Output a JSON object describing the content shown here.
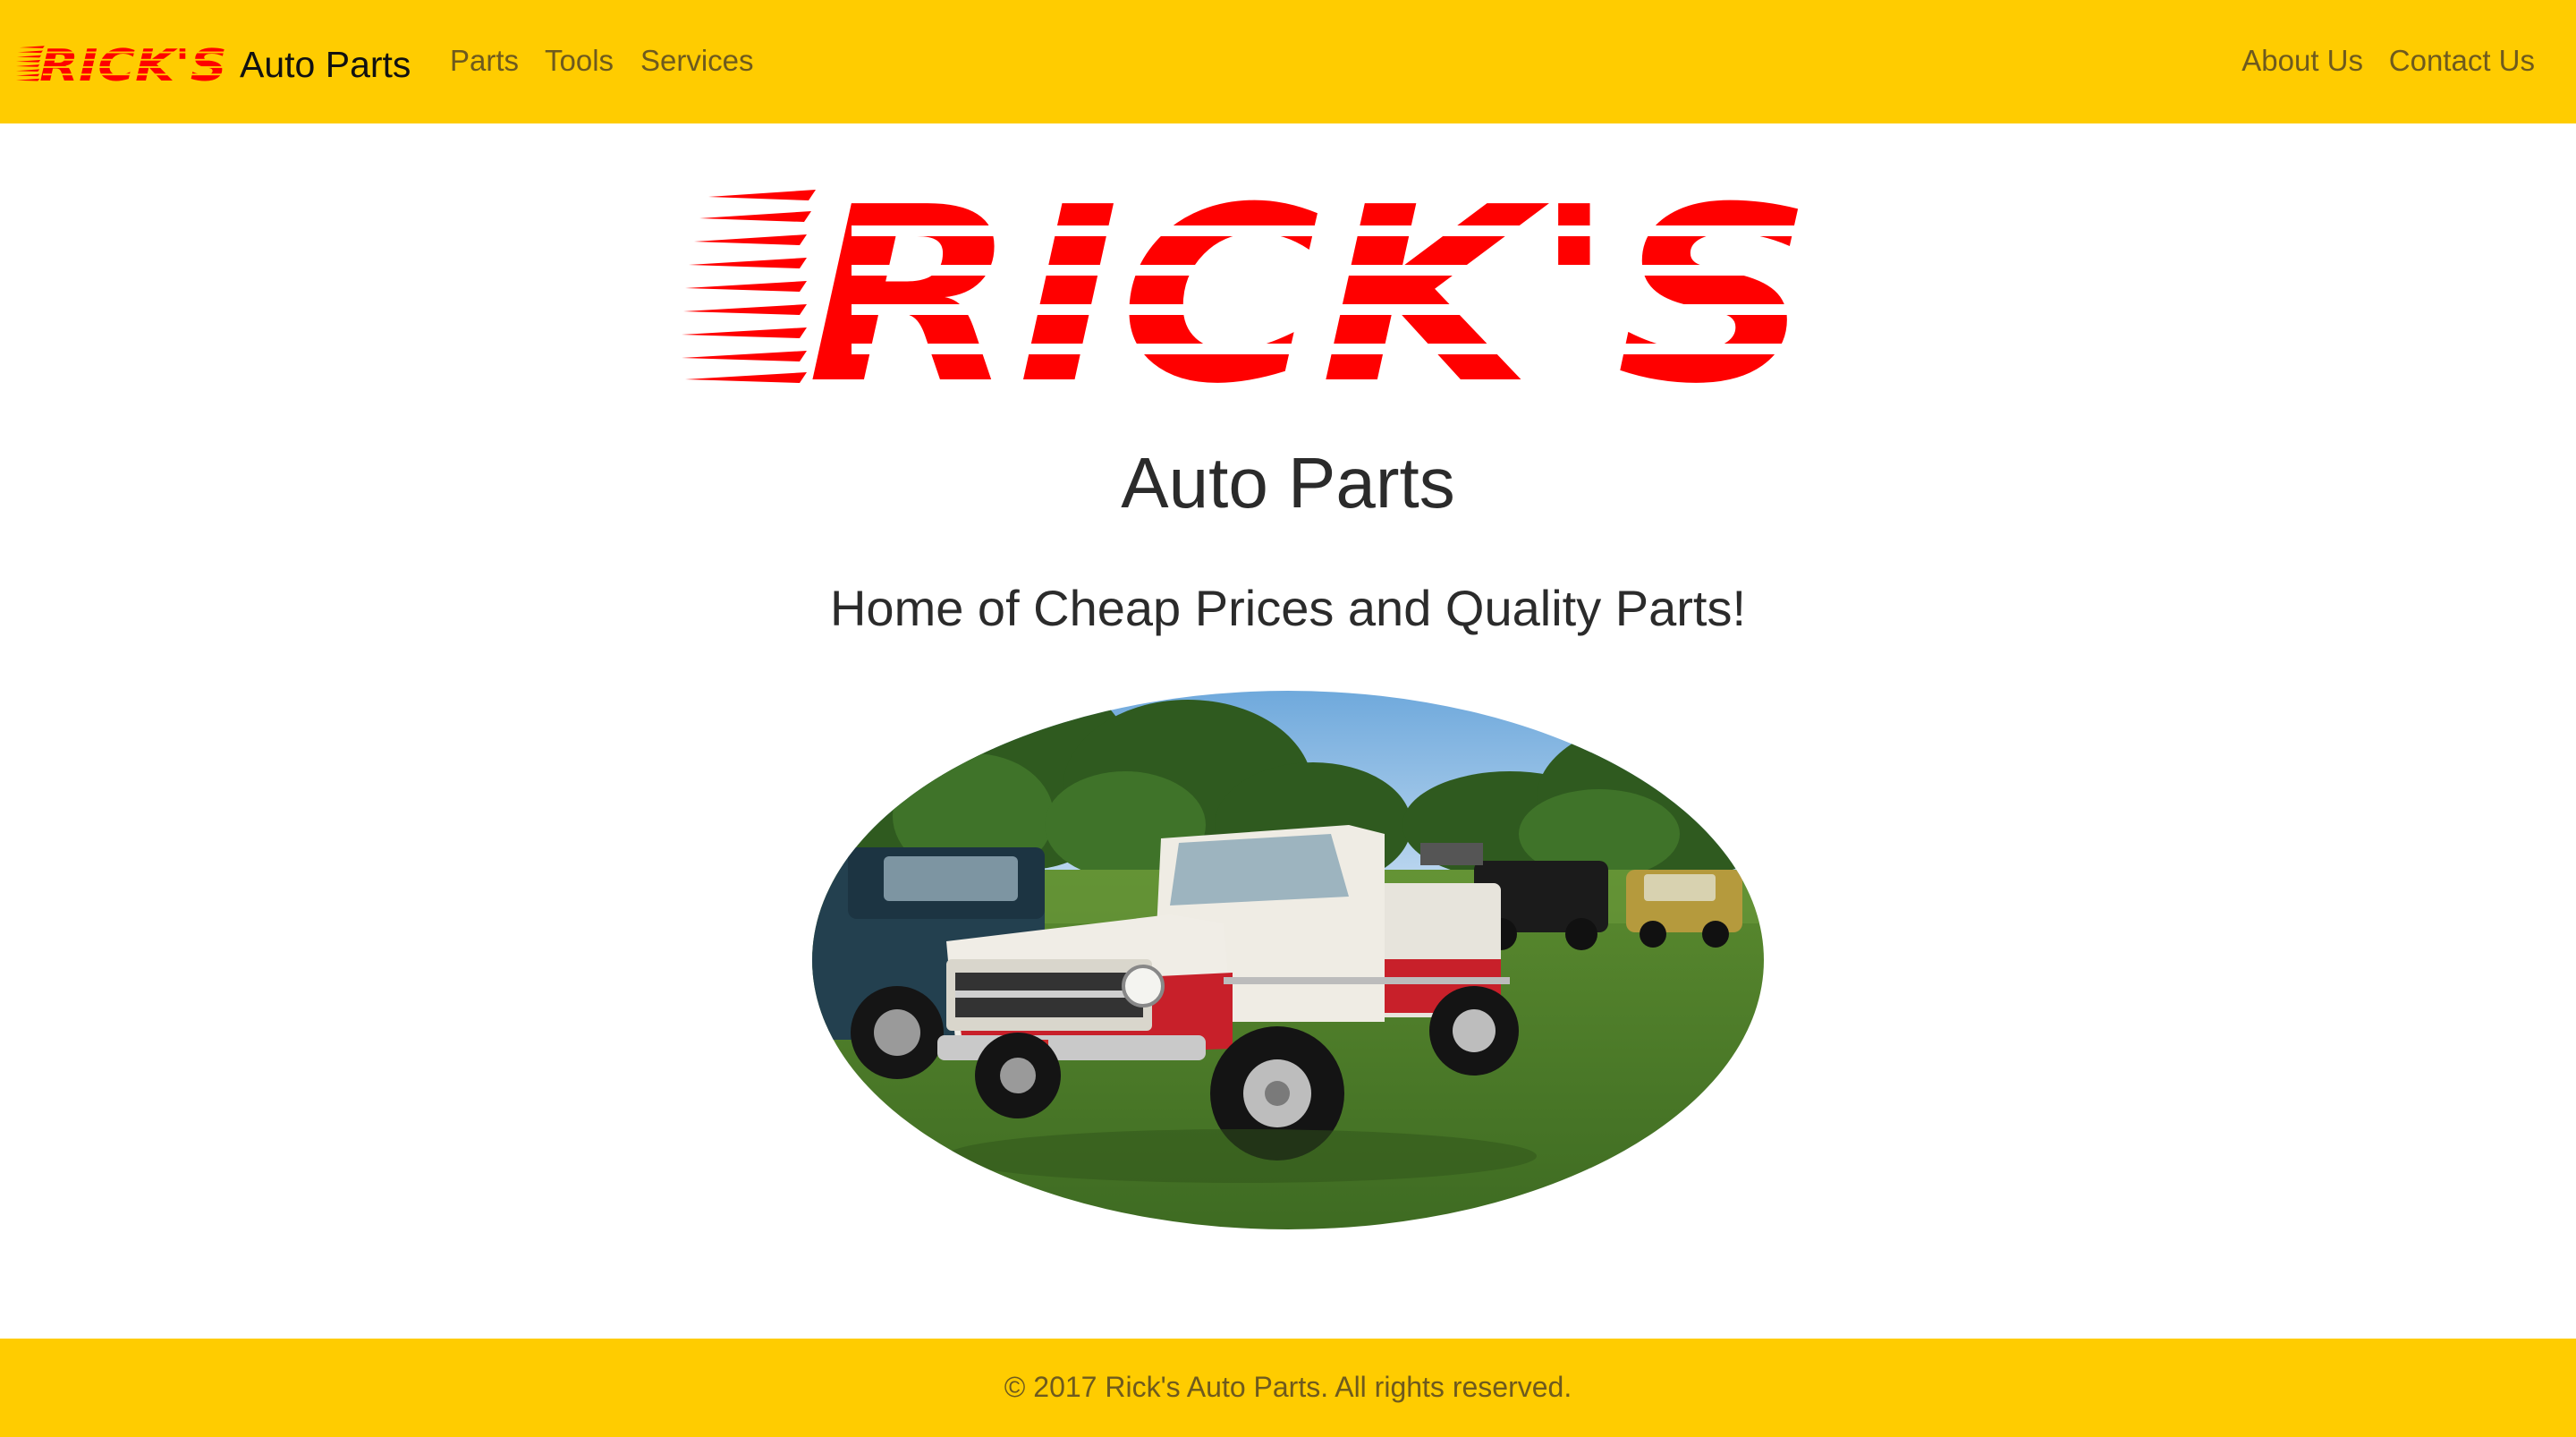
{
  "navbar": {
    "brand_logo_text": "RICK'S",
    "brand_text": "Auto Parts",
    "left_links": [
      "Parts",
      "Tools",
      "Services"
    ],
    "right_links": [
      "About Us",
      "Contact Us"
    ],
    "background_color": "#ffcc00",
    "link_color": "#6e5a1e"
  },
  "hero": {
    "logo_text": "RICK'S",
    "logo_color": "#ff0000",
    "title": "Auto Parts",
    "subtitle": "Home of Cheap Prices and Quality Parts!",
    "image_subject": "truck-photo"
  },
  "footer": {
    "text": "© 2017 Rick's Auto Parts. All rights reserved.",
    "background_color": "#ffcc00"
  }
}
